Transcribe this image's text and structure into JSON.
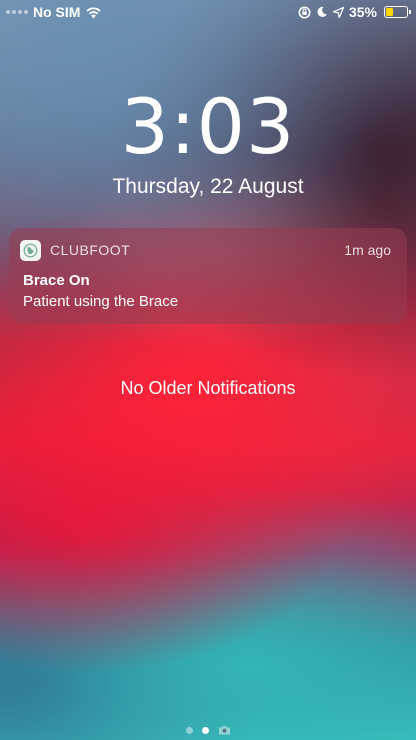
{
  "status_bar": {
    "carrier": "No SIM",
    "battery_percent": "35%",
    "battery_level": 0.35,
    "icons": [
      "signal-dots",
      "wifi-icon",
      "rotation-lock-icon",
      "moon-icon",
      "location-icon",
      "battery-icon"
    ]
  },
  "lock_screen": {
    "time": "3:03",
    "date": "Thursday, 22 August"
  },
  "notification": {
    "app_name": "CLUBFOOT",
    "time": "1m ago",
    "title": "Brace On",
    "body": "Patient using the Brace",
    "app_icon": "clubfoot-app-icon"
  },
  "notification_center": {
    "empty_label": "No Older Notifications"
  },
  "page_indicator": {
    "pages": 2,
    "active_page": 2,
    "trailing_icon": "camera-icon"
  },
  "colors": {
    "battery_fill": "#ffd60a",
    "notification_time": "#ffffffd1"
  }
}
